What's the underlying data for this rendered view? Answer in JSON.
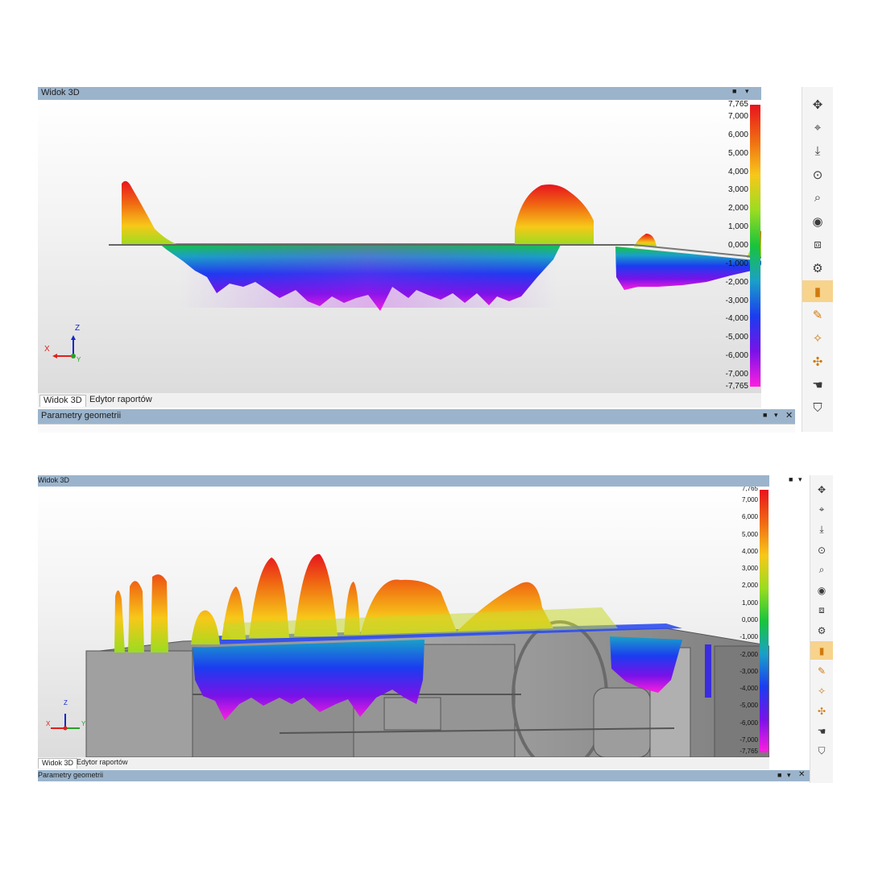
{
  "window1": {
    "title": "Widok 3D",
    "tabs": [
      "Widok 3D",
      "Edytor raportów"
    ],
    "panel_title": "Parametry geometrii"
  },
  "window2": {
    "title": "Widok 3D",
    "tabs": [
      "Widok 3D",
      "Edytor raportów"
    ],
    "panel_title": "Parametry geometrii"
  },
  "axis_labels": {
    "x": "X",
    "y": "Y",
    "z": "Z"
  },
  "legend_labels": [
    "7,765",
    "7,000",
    "6,000",
    "5,000",
    "4,000",
    "3,000",
    "2,000",
    "1,000",
    "0,000",
    "-1,000",
    "-2,000",
    "-3,000",
    "-4,000",
    "-5,000",
    "-6,000",
    "-7,000",
    "-7,765"
  ],
  "colors": {
    "titlebar": "#9bb4cc",
    "selected_tool": "#f7d38c",
    "model_gray": "#9a9a9a",
    "scale": [
      "#e8141e",
      "#f06a12",
      "#f7c819",
      "#9adc20",
      "#18c43c",
      "#1aa0c8",
      "#1b3cf0",
      "#7a12e8",
      "#ff1ee0"
    ]
  },
  "toolbar_icons": [
    "pan-rotate-icon",
    "axis-view-icon",
    "import-icon",
    "zoom-fit-icon",
    "zoom-icon",
    "visibility-icon",
    "cube-icon",
    "settings-icon",
    "color-map-icon",
    "annotation-icon",
    "color-tool-icon",
    "label-move-icon",
    "hand-icon",
    "shield-icon"
  ]
}
